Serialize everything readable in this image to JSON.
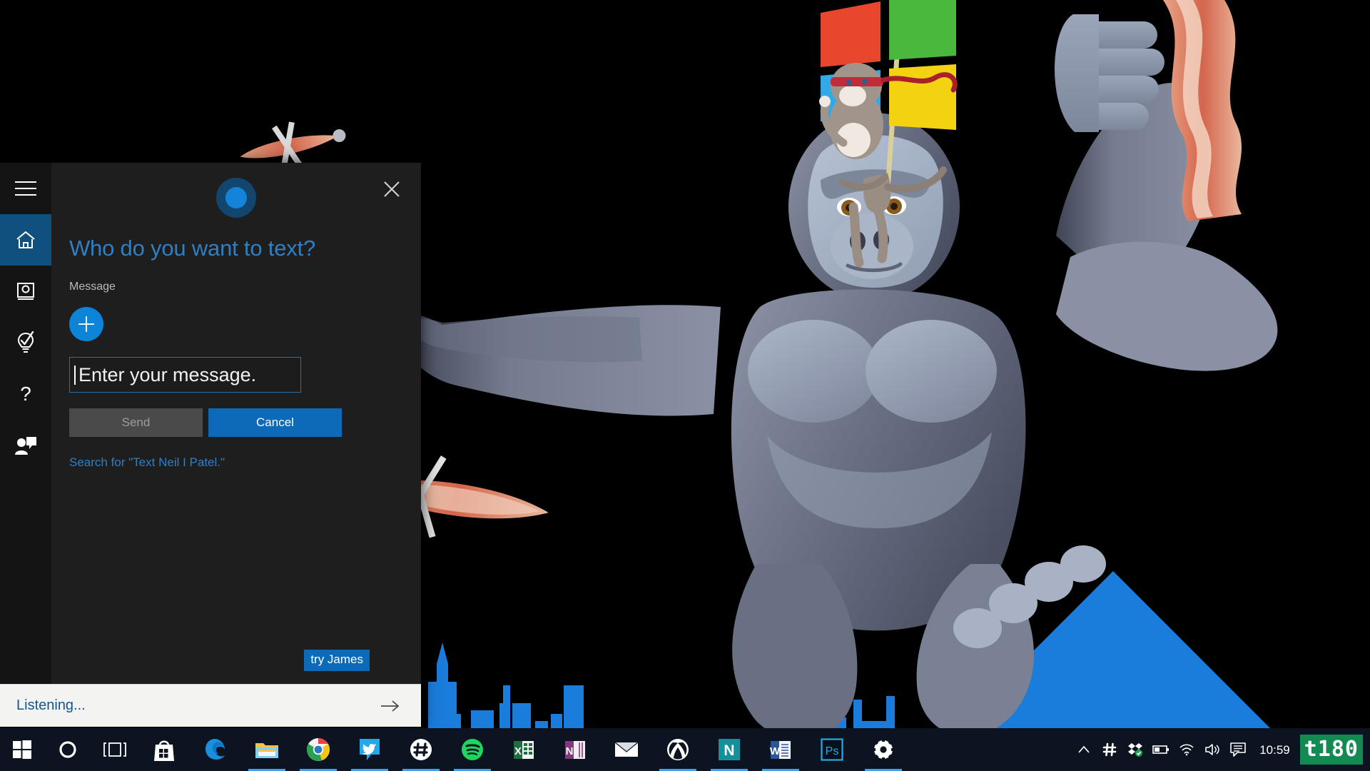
{
  "desktop": {
    "wallpaper_name": "ninja-cat-gorilla-bacon-wallpaper",
    "background_color": "#000000",
    "accent_color": "#0d6ab8",
    "city_color": "#1a7ddc"
  },
  "cortana": {
    "orb_icon": "cortana-orb-icon",
    "close_icon": "close-icon",
    "headline": "Who do you want to text?",
    "message_label": "Message",
    "add_contact_icon": "plus-icon",
    "message_input_value": "Enter your message.",
    "message_input_placeholder": "Enter your message.",
    "send_label": "Send",
    "cancel_label": "Cancel",
    "search_link": "Search for \"Text Neil I Patel.\"",
    "try_badge": "try James",
    "listening_text": "Listening...",
    "listening_go_icon": "arrow-right-icon",
    "rail": [
      {
        "name": "hamburger-menu",
        "icon": "hamburger-icon",
        "active": false
      },
      {
        "name": "home",
        "icon": "home-icon",
        "active": true
      },
      {
        "name": "notebook",
        "icon": "notebook-icon",
        "active": false
      },
      {
        "name": "reminders",
        "icon": "lightbulb-check-icon",
        "active": false
      },
      {
        "name": "help",
        "icon": "question-mark-icon",
        "active": false
      },
      {
        "name": "feedback",
        "icon": "feedback-person-icon",
        "active": false
      }
    ]
  },
  "taskbar": {
    "start_icon": "windows-start-icon",
    "cortana_icon": "cortana-circle-icon",
    "taskview_icon": "task-view-icon",
    "apps": [
      {
        "name": "microsoft-store",
        "label": "Microsoft Store",
        "icon": "store-bag-icon",
        "running": false
      },
      {
        "name": "microsoft-edge",
        "label": "Microsoft Edge",
        "icon": "edge-icon",
        "running": false
      },
      {
        "name": "file-explorer",
        "label": "File Explorer",
        "icon": "folder-icon",
        "running": false
      },
      {
        "name": "google-chrome",
        "label": "Google Chrome",
        "icon": "chrome-icon",
        "running": true
      },
      {
        "name": "twitter",
        "label": "Twitter",
        "icon": "twitter-bird-icon",
        "running": true
      },
      {
        "name": "slack",
        "label": "Slack",
        "icon": "slack-hash-icon",
        "running": true
      },
      {
        "name": "spotify",
        "label": "Spotify",
        "icon": "spotify-icon",
        "running": true
      },
      {
        "name": "excel",
        "label": "Excel",
        "icon": "excel-icon",
        "running": false
      },
      {
        "name": "onenote",
        "label": "OneNote",
        "icon": "onenote-icon",
        "running": false
      },
      {
        "name": "mail",
        "label": "Mail",
        "icon": "mail-envelope-icon",
        "running": false
      },
      {
        "name": "xbox",
        "label": "Xbox",
        "icon": "xbox-icon",
        "running": true
      },
      {
        "name": "nitro",
        "label": "N app",
        "icon": "letter-n-icon",
        "running": true
      },
      {
        "name": "word",
        "label": "Word",
        "icon": "word-icon",
        "running": true
      },
      {
        "name": "photoshop",
        "label": "Photoshop",
        "icon": "photoshop-ps-icon",
        "running": false
      },
      {
        "name": "settings",
        "label": "Settings",
        "icon": "gear-icon",
        "running": true
      }
    ],
    "tray": [
      {
        "name": "show-hidden-icons",
        "icon": "chevron-up-icon"
      },
      {
        "name": "slack-tray",
        "icon": "slack-hash-icon"
      },
      {
        "name": "dropbox-tray",
        "icon": "dropbox-icon"
      },
      {
        "name": "battery",
        "icon": "battery-icon"
      },
      {
        "name": "network",
        "icon": "wifi-icon"
      },
      {
        "name": "volume",
        "icon": "speaker-icon"
      },
      {
        "name": "action-center",
        "icon": "action-center-icon"
      }
    ],
    "clock_time": "10:59",
    "watermark": "t180"
  }
}
